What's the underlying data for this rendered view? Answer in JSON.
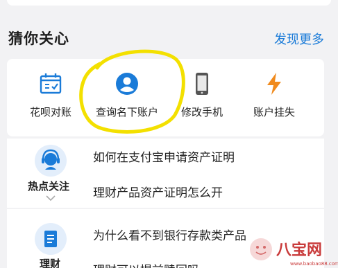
{
  "section": {
    "title": "猜你关心",
    "more_link": "发现更多"
  },
  "shortcuts": [
    {
      "label": "花呗对账",
      "icon": "calendar-bill-icon"
    },
    {
      "label": "查询名下账户",
      "icon": "user-account-icon"
    },
    {
      "label": "修改手机",
      "icon": "mobile-phone-icon"
    },
    {
      "label": "账户挂失",
      "icon": "lightning-icon"
    }
  ],
  "hot_topics": {
    "label": "热点关注",
    "icon": "customer-service-icon",
    "questions": [
      "如何在支付宝申请资产证明",
      "理财产品资产证明怎么开"
    ]
  },
  "finance": {
    "label": "理财",
    "icon": "document-icon",
    "questions": [
      "为什么看不到银行存款类产品",
      "理财可以提前赎回吗"
    ]
  },
  "watermark": {
    "text": "八宝网",
    "url_text": "www.baobao88.com"
  },
  "colors": {
    "accent": "#1a7bd8",
    "highlight": "#f3e000",
    "icon_orange": "#f08a1c",
    "page_bg": "#f2f2f4"
  }
}
